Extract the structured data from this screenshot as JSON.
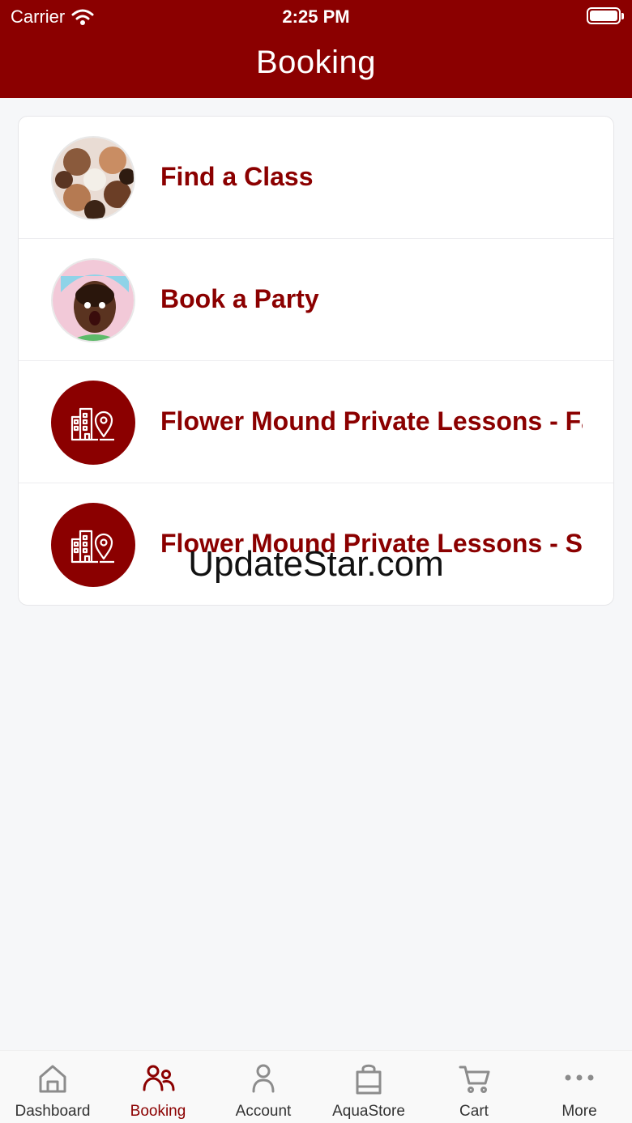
{
  "status_bar": {
    "carrier": "Carrier",
    "time": "2:25 PM"
  },
  "header": {
    "title": "Booking"
  },
  "booking_items": [
    {
      "label": "Find a Class",
      "icon": "class-photo"
    },
    {
      "label": "Book a Party",
      "icon": "party-photo"
    },
    {
      "label": "Flower Mound Private Lessons - Fa",
      "icon": "building-location-icon"
    },
    {
      "label": "Flower Mound Private Lessons - S",
      "icon": "building-location-icon"
    }
  ],
  "watermark": "UpdateStar.com",
  "tabs": [
    {
      "label": "Dashboard",
      "icon": "home-icon",
      "active": false
    },
    {
      "label": "Booking",
      "icon": "people-icon",
      "active": true
    },
    {
      "label": "Account",
      "icon": "person-icon",
      "active": false
    },
    {
      "label": "AquaStore",
      "icon": "shopping-bag-icon",
      "active": false
    },
    {
      "label": "Cart",
      "icon": "cart-icon",
      "active": false
    },
    {
      "label": "More",
      "icon": "more-dots-icon",
      "active": false
    }
  ],
  "colors": {
    "brand": "#8b0000",
    "background": "#f6f7f9",
    "tab_inactive": "#8c8c8c"
  }
}
